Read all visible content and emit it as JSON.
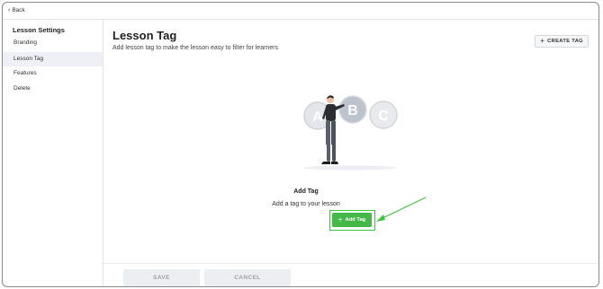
{
  "topbar": {
    "back_label": "Back"
  },
  "sidebar": {
    "title": "Lesson Settings",
    "items": [
      {
        "label": "Branding",
        "active": false
      },
      {
        "label": "Lesson Tag",
        "active": true
      },
      {
        "label": "Features",
        "active": false
      },
      {
        "label": "Delete",
        "active": false
      }
    ]
  },
  "main": {
    "title": "Lesson Tag",
    "subtitle": "Add lesson tag to make the lesson easy to filter for learners",
    "create_button_label": "CREATE TAG",
    "illustration": {
      "letters": [
        "A",
        "B",
        "C"
      ]
    },
    "empty_state": {
      "title": "Add Tag",
      "subtitle": "Add a tag to your lesson",
      "add_button_label": "Add Tag"
    }
  },
  "footer": {
    "save_label": "SAVE",
    "cancel_label": "CANCEL"
  },
  "colors": {
    "accent_green": "#45b84a",
    "highlight_green": "#3ec43e",
    "active_bg": "#eef0f6"
  }
}
